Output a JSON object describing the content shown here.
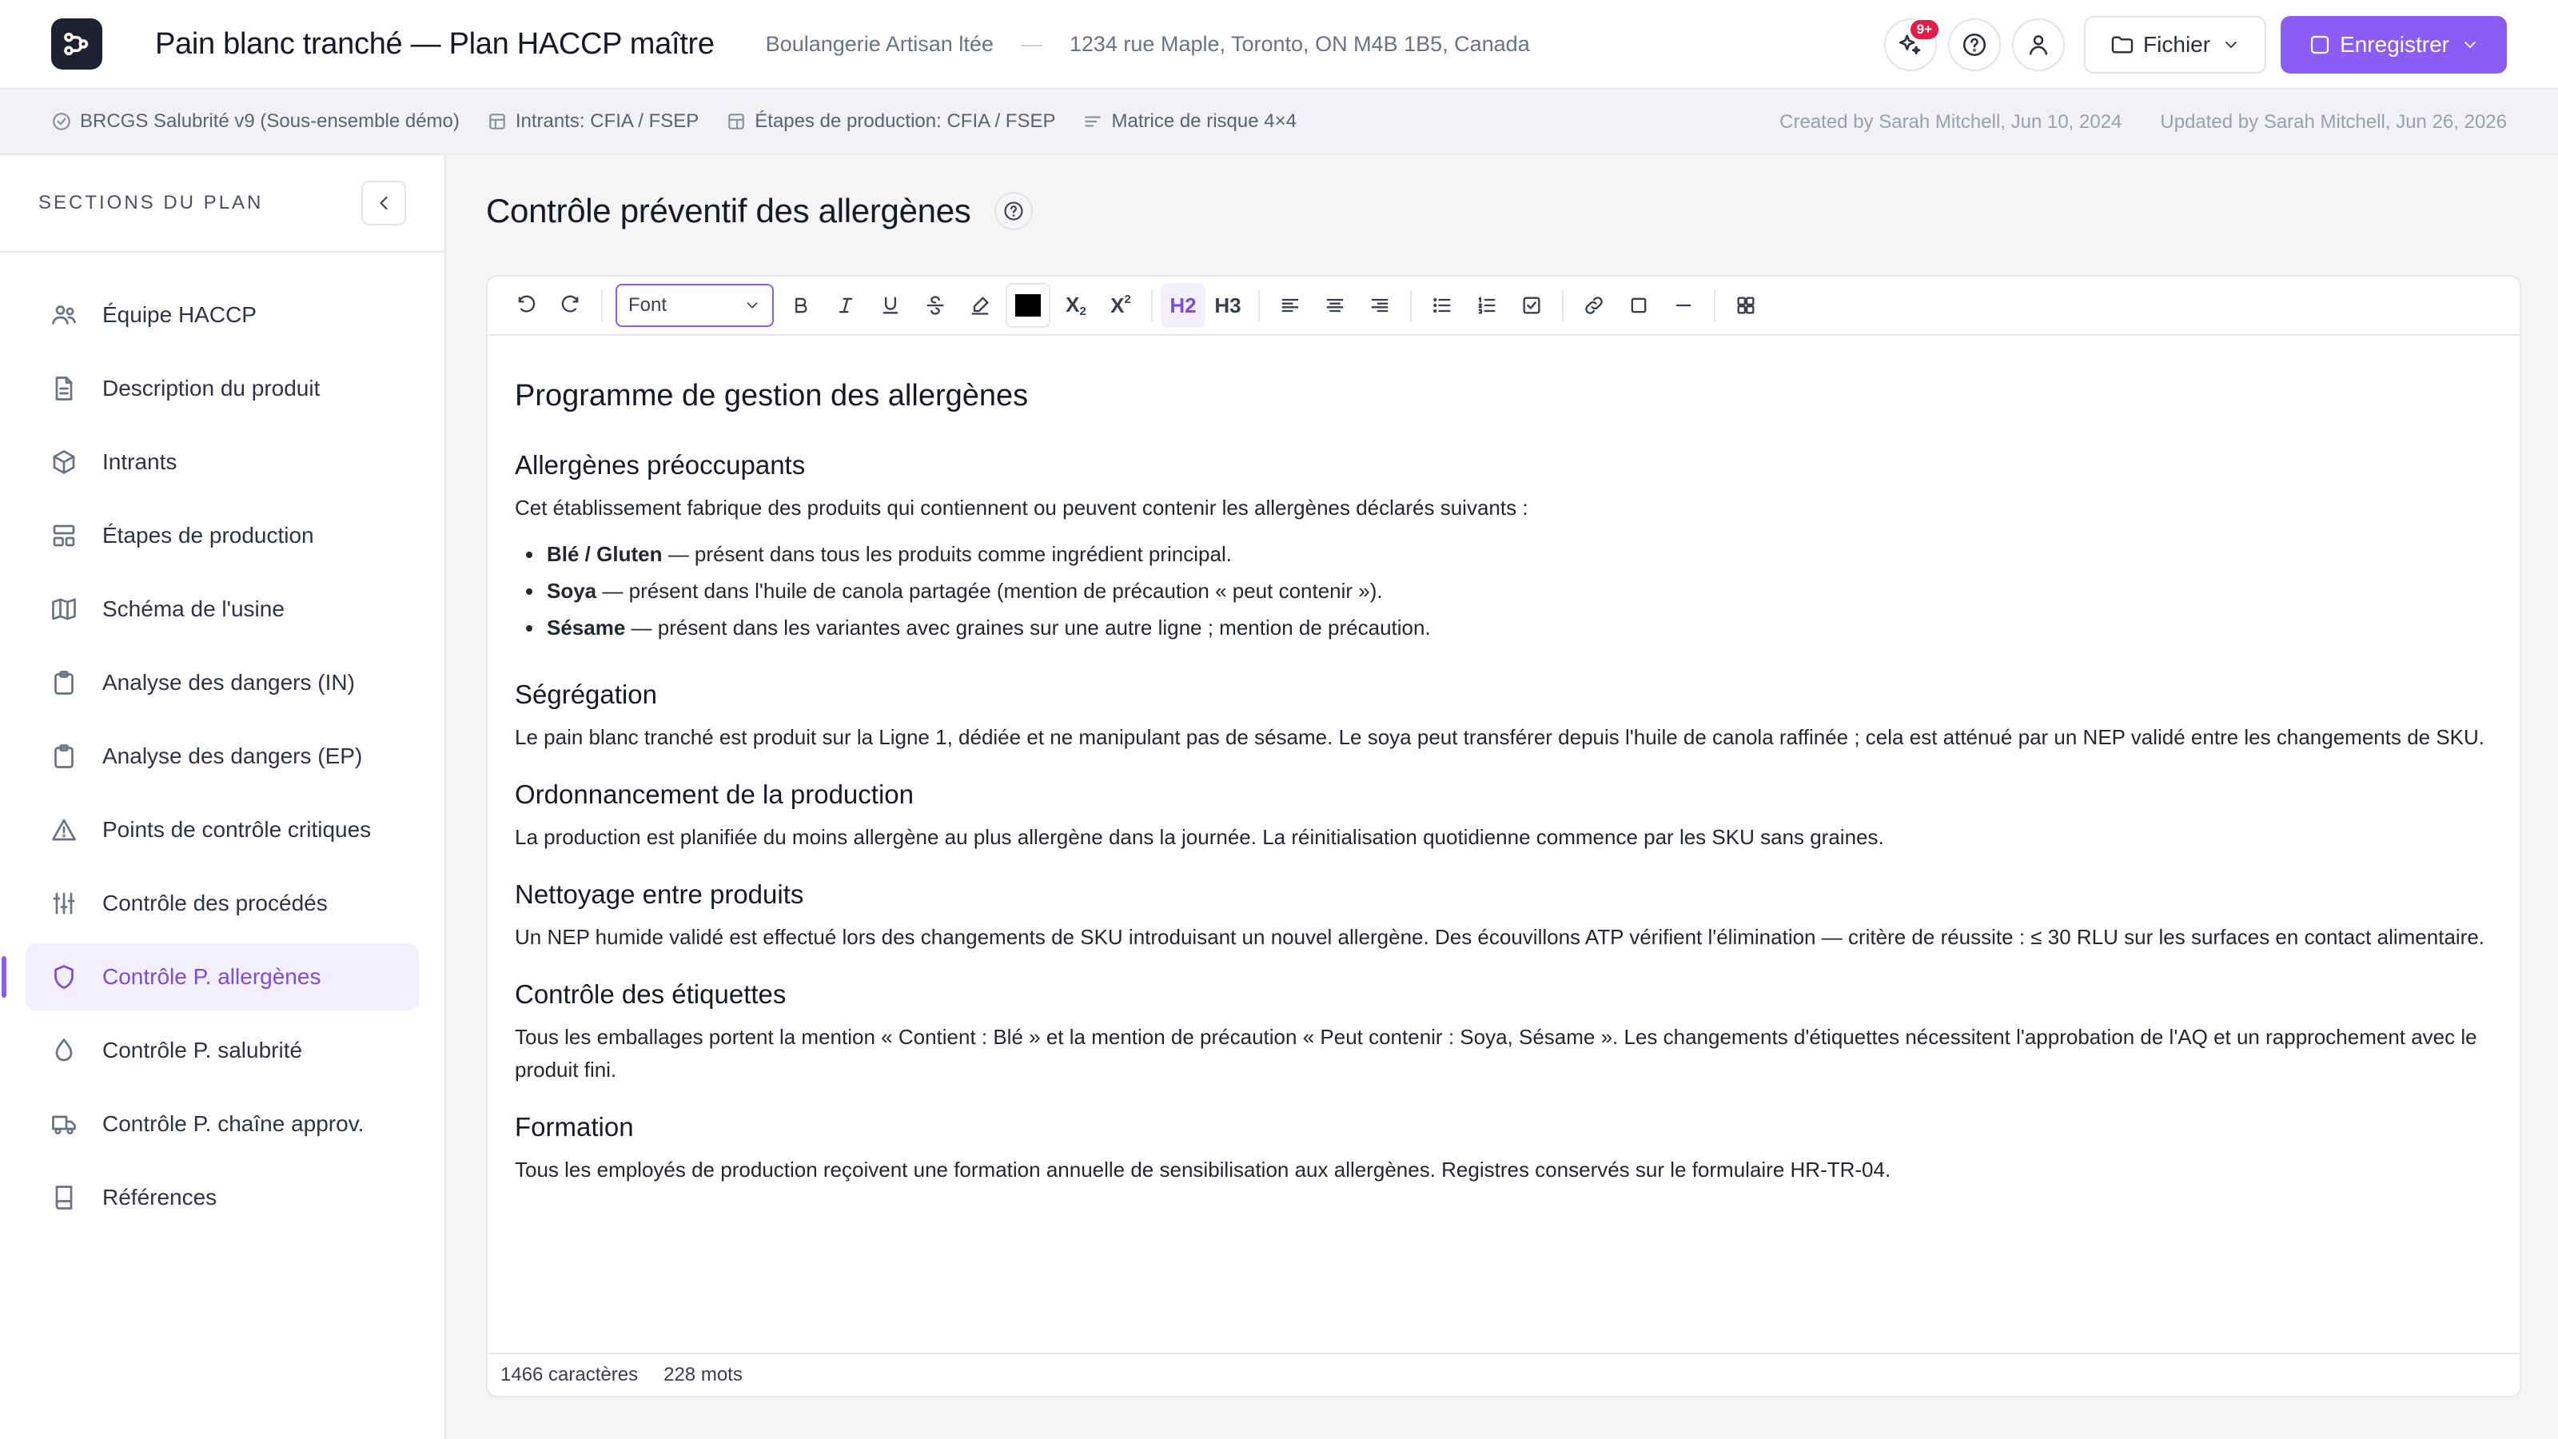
{
  "header": {
    "title": "Pain blanc tranché — Plan HACCP maître",
    "company": "Boulangerie Artisan ltée",
    "separator": "—",
    "address": "1234 rue Maple, Toronto, ON M4B 1B5, Canada",
    "notification_count": "9+",
    "file_button": "Fichier",
    "save_button": "Enregistrer",
    "accent_color": "#8b5cf6"
  },
  "meta": {
    "standard": "BRCGS Salubrité v9 (Sous-ensemble démo)",
    "inputs": "Intrants: CFIA / FSEP",
    "steps": "Étapes de production: CFIA / FSEP",
    "matrix": "Matrice de risque 4×4",
    "created": "Created by Sarah Mitchell, Jun 10, 2024",
    "updated": "Updated by Sarah Mitchell, Jun 26, 2026"
  },
  "sidebar": {
    "title": "SECTIONS DU PLAN",
    "items": [
      {
        "label": "Équipe HACCP",
        "icon": "users-icon"
      },
      {
        "label": "Description du produit",
        "icon": "document-icon"
      },
      {
        "label": "Intrants",
        "icon": "box-icon"
      },
      {
        "label": "Étapes de production",
        "icon": "steps-icon"
      },
      {
        "label": "Schéma de l'usine",
        "icon": "map-icon"
      },
      {
        "label": "Analyse des dangers (IN)",
        "icon": "clipboard-icon"
      },
      {
        "label": "Analyse des dangers (EP)",
        "icon": "clipboard-icon"
      },
      {
        "label": "Points de contrôle critiques",
        "icon": "warning-icon"
      },
      {
        "label": "Contrôle des procédés",
        "icon": "sliders-icon"
      },
      {
        "label": "Contrôle P. allergènes",
        "icon": "shield-icon",
        "active": true
      },
      {
        "label": "Contrôle P. salubrité",
        "icon": "droplet-icon"
      },
      {
        "label": "Contrôle P. chaîne approv.",
        "icon": "truck-icon"
      },
      {
        "label": "Références",
        "icon": "book-icon"
      }
    ]
  },
  "main": {
    "title": "Contrôle préventif des allergènes",
    "toolbar": {
      "font_select": "Font",
      "h2": "H2",
      "h3": "H3",
      "text_color": "#000000"
    },
    "doc": {
      "h2": "Programme de gestion des allergènes",
      "s1_title": "Allergènes préoccupants",
      "s1_intro": "Cet établissement fabrique des produits qui contiennent ou peuvent contenir les allergènes déclarés suivants :",
      "allergens": [
        {
          "name": "Blé / Gluten",
          "text": " — présent dans tous les produits comme ingrédient principal."
        },
        {
          "name": "Soya",
          "text": " — présent dans l'huile de canola partagée (mention de précaution « peut contenir »)."
        },
        {
          "name": "Sésame",
          "text": " — présent dans les variantes avec graines sur une autre ligne ; mention de précaution."
        }
      ],
      "s2_title": "Ségrégation",
      "s2_text": "Le pain blanc tranché est produit sur la Ligne 1, dédiée et ne manipulant pas de sésame. Le soya peut transférer depuis l'huile de canola raffinée ; cela est atténué par un NEP validé entre les changements de SKU.",
      "s3_title": "Ordonnancement de la production",
      "s3_text": "La production est planifiée du moins allergène au plus allergène dans la journée. La réinitialisation quotidienne commence par les SKU sans graines.",
      "s4_title": "Nettoyage entre produits",
      "s4_text": "Un NEP humide validé est effectué lors des changements de SKU introduisant un nouvel allergène. Des écouvillons ATP vérifient l'élimination — critère de réussite : ≤ 30 RLU sur les surfaces en contact alimentaire.",
      "s5_title": "Contrôle des étiquettes",
      "s5_text": "Tous les emballages portent la mention « Contient : Blé » et la mention de précaution « Peut contenir : Soya, Sésame ». Les changements d'étiquettes nécessitent l'approbation de l'AQ et un rapprochement avec le produit fini.",
      "s6_title": "Formation",
      "s6_text": "Tous les employés de production reçoivent une formation annuelle de sensibilisation aux allergènes. Registres conservés sur le formulaire HR-TR-04."
    },
    "footer": {
      "chars": "1466 caractères",
      "words": "228 mots"
    }
  }
}
